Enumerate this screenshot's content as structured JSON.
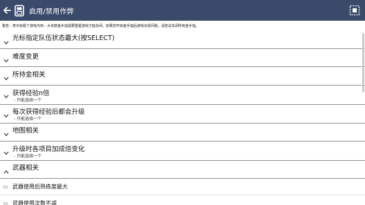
{
  "appbar": {
    "title": "启用/禁用作弊",
    "back_icon": "arrow-left-icon",
    "logo_icon": "app-logo-icon",
    "menu_icon": "select-all-icon",
    "color": "#3a4a6a"
  },
  "warning": "警告：表示标题了游戏内存，大多数金手指需要重置游戏才能关闭。如果您开启金手指后游戏出现问题，请尝试关闭所有金手指。",
  "sections": [
    {
      "label": "光标指定队伍状态最大(按SELECT)",
      "sub": "",
      "expanded": false
    },
    {
      "label": "难度变更",
      "sub": "",
      "expanded": false
    },
    {
      "label": "所持金相关",
      "sub": "",
      "expanded": false
    },
    {
      "label": "获得经验n倍",
      "sub": "- 只能选择一个",
      "expanded": false
    },
    {
      "label": "每次获得经验后都会升级",
      "sub": "- 只能选择一个",
      "expanded": false
    },
    {
      "label": "地图相关",
      "sub": "",
      "expanded": false
    },
    {
      "label": "升级时各项目加成倍变化",
      "sub": "- 只能选择一个",
      "expanded": false
    },
    {
      "label": "武器相关",
      "sub": "",
      "expanded": true
    }
  ],
  "options": [
    {
      "label": "武器使用后熟练度最大",
      "checked": false
    },
    {
      "label": "武器使用次数不减",
      "checked": false
    }
  ]
}
